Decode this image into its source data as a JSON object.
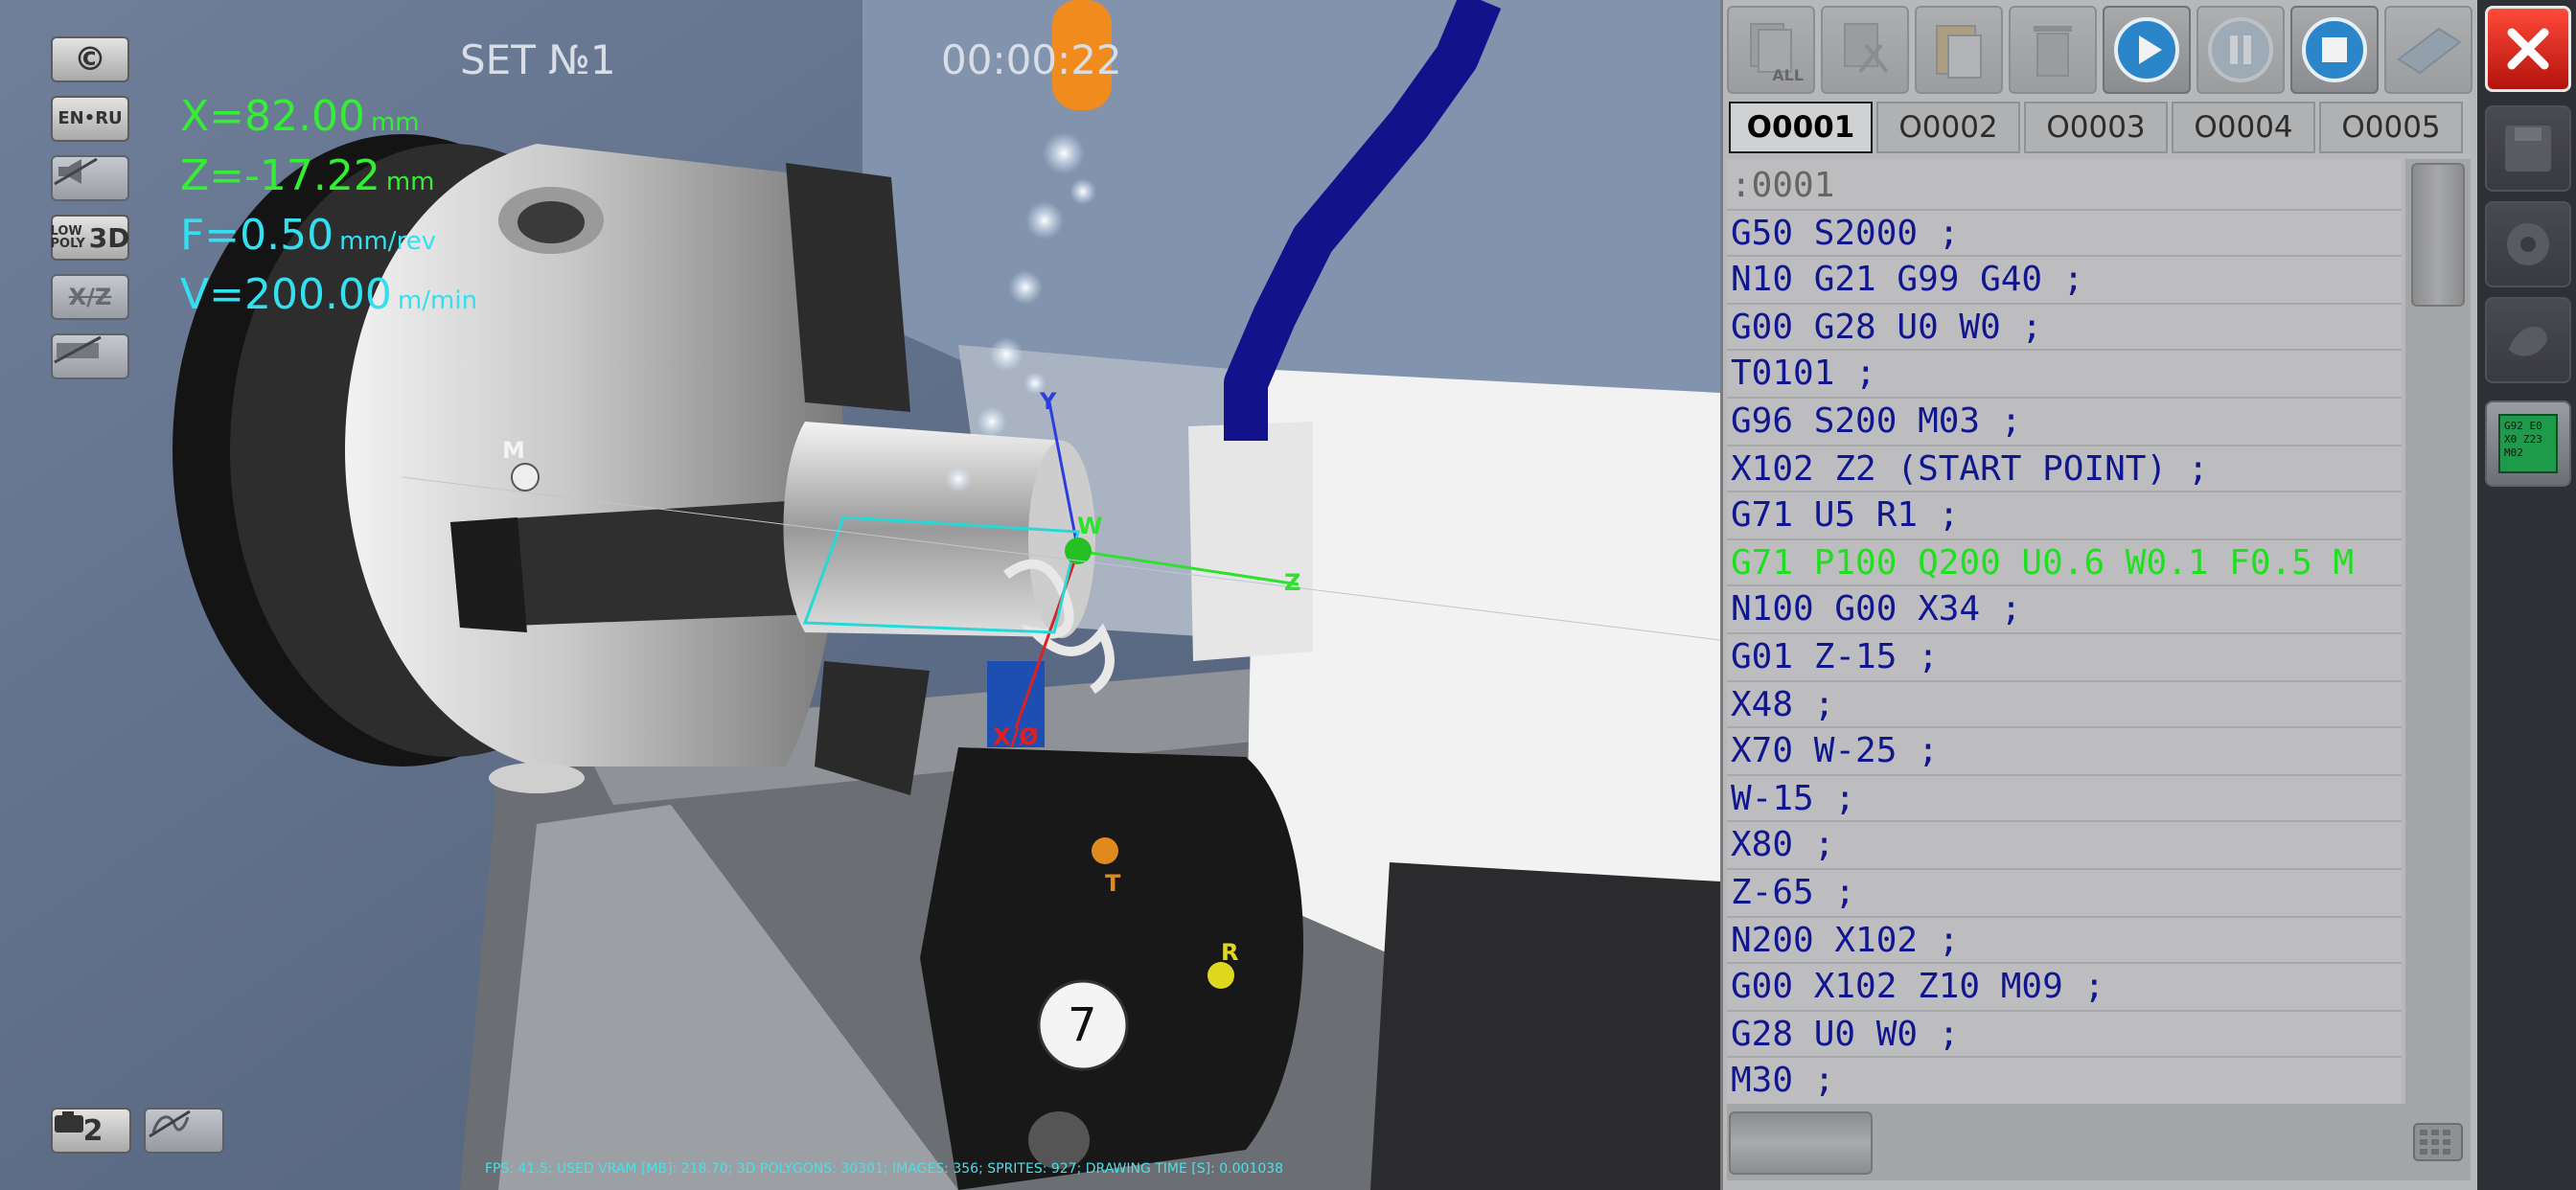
{
  "hud": {
    "copyright_label": "©",
    "lang_label": "EN•RU",
    "lowpoly_line1": "LOW",
    "lowpoly_line2": "POLY",
    "lowpoly_3d": "3D",
    "xz_label": "X/Z",
    "camera_label": "2",
    "x_value": "X=82.00",
    "x_unit": "mm",
    "z_value": "Z=-17.22",
    "z_unit": "mm",
    "f_value": "F=0.50",
    "f_unit": "mm/rev",
    "v_value": "V=200.00",
    "v_unit": "m/min",
    "set_title": "SET №1",
    "timer": "00:00:22",
    "fps_line": "FPS: 41.5; USED VRAM [MB]: 218.70; 3D POLYGONS: 30301; IMAGES: 356; SPRITES: 927; DRAWING TIME [S]: 0.001038"
  },
  "scene_labels": {
    "m": "M",
    "y": "Y",
    "w": "W",
    "z": "Z",
    "x": "X/Ø",
    "t": "T",
    "r": "R",
    "turret_number": "7"
  },
  "toolbar": {
    "all_label": "ALL",
    "icons": [
      "copy-all-icon",
      "cut-icon",
      "paste-icon",
      "trash-icon",
      "play-icon",
      "pause-icon",
      "stop-icon",
      "book-icon"
    ]
  },
  "tabs": [
    "O0001",
    "O0002",
    "O0003",
    "O0004",
    "O0005"
  ],
  "active_tab": "O0001",
  "code_lines": [
    ":0001",
    "G50 S2000 ;",
    "N10 G21 G99 G40 ;",
    "G00 G28 U0 W0 ;",
    "T0101 ;",
    "G96 S200 M03 ;",
    "X102 Z2 (START POINT) ;",
    "G71 U5 R1 ;",
    "G71 P100 Q200 U0.6 W0.1 F0.5 M",
    "N100 G00 X34 ;",
    "G01 Z-15 ;",
    "X48 ;",
    "X70 W-25 ;",
    "W-15 ;",
    "X80 ;",
    "Z-65 ;",
    "N200 X102 ;",
    "G00 X102 Z10 M09 ;",
    "G28 U0 W0 ;",
    "M30 ;"
  ],
  "current_line_index": 8,
  "side": {
    "gcode_icon_line1": "G92 E0",
    "gcode_icon_line2": "X0 Z23",
    "gcode_icon_line3": "M02"
  },
  "colors": {
    "readout_green": "#33ee33",
    "readout_cyan": "#33e0f0",
    "code_blue": "#10168f",
    "code_current": "#1fe01f",
    "close_red": "#e0241a"
  }
}
